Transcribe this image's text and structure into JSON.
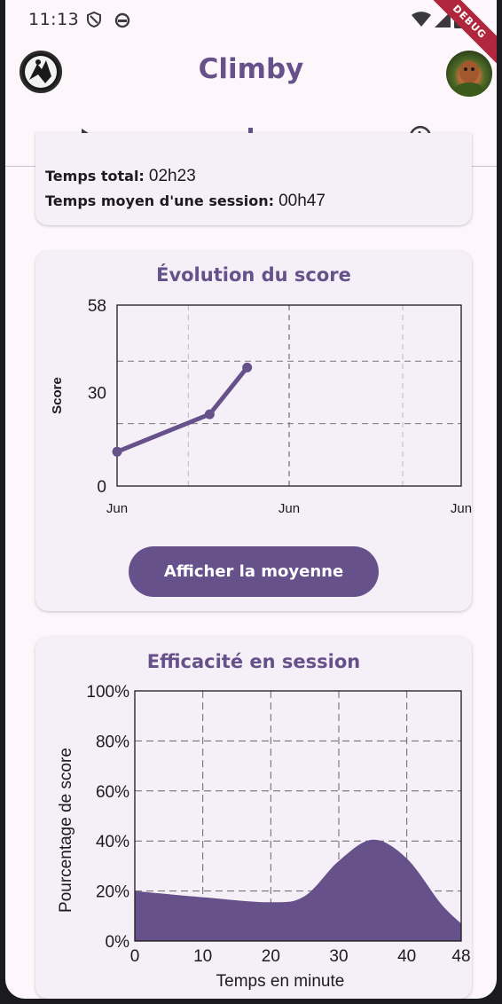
{
  "status_bar": {
    "time": "11:13",
    "icons": [
      "shield-icon",
      "android-icon",
      "wifi-icon",
      "cell-signal-icon",
      "battery-icon"
    ],
    "debug_banner": "DEBUG"
  },
  "app_bar": {
    "title": "Climby",
    "left_avatar": "climber-logo",
    "right_avatar": "user-avatar"
  },
  "tabs": [
    {
      "name": "play",
      "icon": "play-icon"
    },
    {
      "name": "stats",
      "icon": "bar-chart-icon",
      "selected": true
    },
    {
      "name": "history",
      "icon": "history-icon"
    }
  ],
  "stats": {
    "total_label": "Temps total:",
    "total_value": "02h23",
    "avg_label": "Temps moyen d'une session:",
    "avg_value": "00h47"
  },
  "score_card": {
    "title": "Évolution du score",
    "button_label": "Afficher la moyenne"
  },
  "efficiency_card": {
    "title": "Efficacité en session"
  },
  "colors": {
    "primary": "#66518a",
    "background": "#fdf7fc",
    "card": "#f5eff7"
  },
  "chart_data": [
    {
      "type": "line",
      "ylabel": "Score",
      "ylim": [
        0,
        58
      ],
      "yticks": [
        "58",
        "30",
        "0"
      ],
      "xticks": [
        "Jun",
        "Jun",
        "Jun"
      ],
      "grid": true,
      "series": [
        {
          "values": [
            11,
            23,
            38
          ]
        }
      ]
    },
    {
      "type": "area",
      "xlabel": "Temps en minute",
      "ylabel": "Pourcentage de score",
      "xlim": [
        0,
        48
      ],
      "ylim": [
        0,
        100
      ],
      "xticks": [
        "0",
        "10",
        "20",
        "30",
        "40",
        "48"
      ],
      "yticks": [
        "0%",
        "20%",
        "40%",
        "60%",
        "80%",
        "100%"
      ],
      "grid": true,
      "x": [
        0,
        10,
        20,
        25,
        30,
        35,
        40,
        45,
        48
      ],
      "series": [
        {
          "values": [
            20,
            17.5,
            15.5,
            18,
            32,
            40.5,
            33,
            15,
            7
          ]
        }
      ]
    }
  ]
}
